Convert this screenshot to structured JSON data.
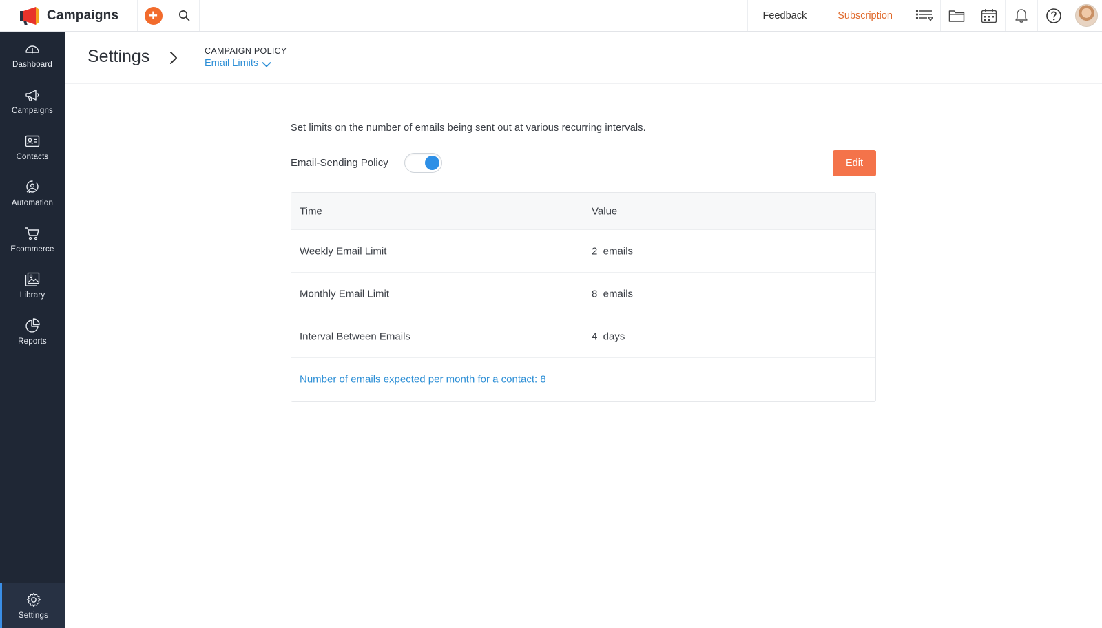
{
  "app": {
    "name": "Campaigns"
  },
  "topbar": {
    "feedback_label": "Feedback",
    "subscription_label": "Subscription",
    "icons": [
      "add-icon",
      "search-icon",
      "list-icon",
      "folder-icon",
      "calendar-icon",
      "bell-icon",
      "help-icon",
      "avatar"
    ]
  },
  "sidebar": {
    "items": [
      {
        "label": "Dashboard",
        "icon": "dashboard-icon"
      },
      {
        "label": "Campaigns",
        "icon": "megaphone-icon"
      },
      {
        "label": "Contacts",
        "icon": "contacts-icon"
      },
      {
        "label": "Automation",
        "icon": "automation-icon"
      },
      {
        "label": "Ecommerce",
        "icon": "cart-icon"
      },
      {
        "label": "Library",
        "icon": "library-icon"
      },
      {
        "label": "Reports",
        "icon": "reports-icon"
      }
    ],
    "settings_label": "Settings",
    "active": "Settings"
  },
  "header": {
    "title": "Settings",
    "breadcrumb_section": "CAMPAIGN POLICY",
    "breadcrumb_current": "Email Limits"
  },
  "content": {
    "description": "Set limits on the number of emails being sent out at various recurring intervals.",
    "policy_label": "Email-Sending Policy",
    "policy_enabled": true,
    "edit_label": "Edit",
    "table": {
      "headers": {
        "time": "Time",
        "value": "Value"
      },
      "rows": [
        {
          "time": "Weekly Email Limit",
          "value": "2  emails"
        },
        {
          "time": "Monthly Email Limit",
          "value": "8  emails"
        },
        {
          "time": "Interval Between Emails",
          "value": "4  days"
        }
      ],
      "footer": "Number of emails expected per month for a contact: 8"
    }
  },
  "colors": {
    "sidebar_bg": "#1f2735",
    "accent_blue": "#2d8fd6",
    "edit_button": "#f4734a",
    "add_button": "#f26b2c",
    "subscription_text": "#e06a2c"
  }
}
